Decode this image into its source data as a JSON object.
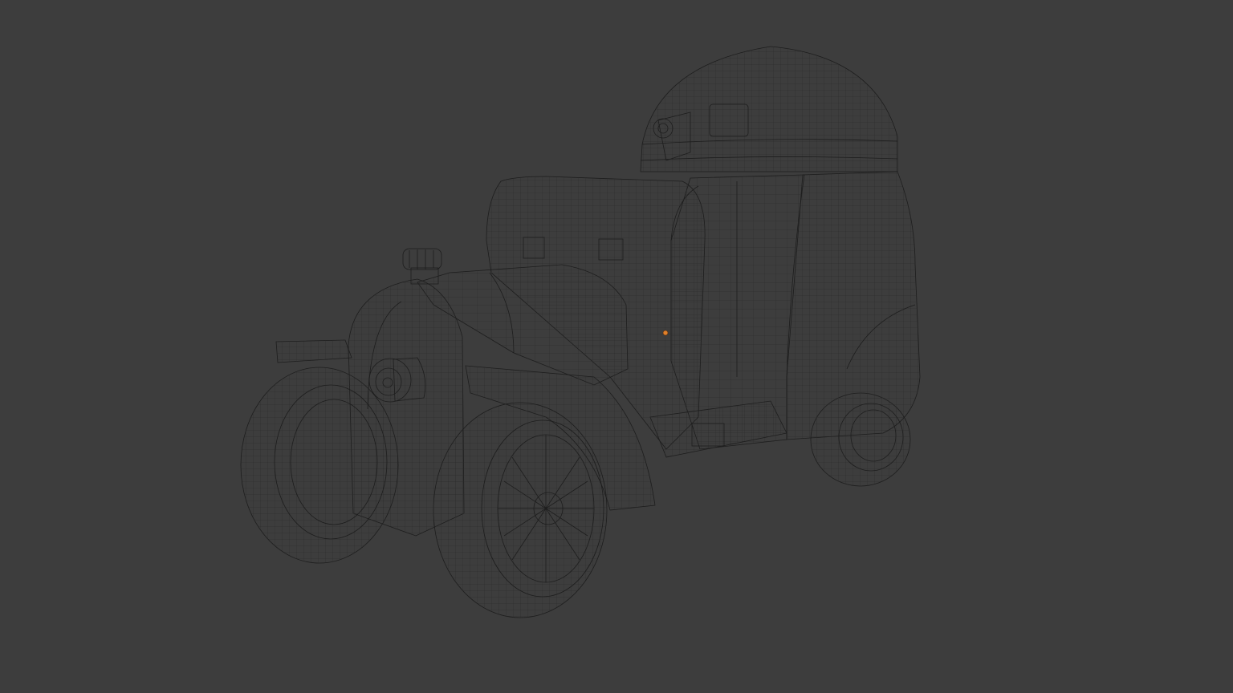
{
  "viewport": {
    "background_color": "#3d3d3d",
    "mode": "wireframe-overlay"
  },
  "object": {
    "kind": "armored-car-mesh",
    "surface_color": "#a9acad",
    "highlight_color": "#d4d6d6",
    "shadow_color": "#7d8081",
    "wire_color": "#1d1d1d",
    "origin_color": "#e0802a"
  }
}
